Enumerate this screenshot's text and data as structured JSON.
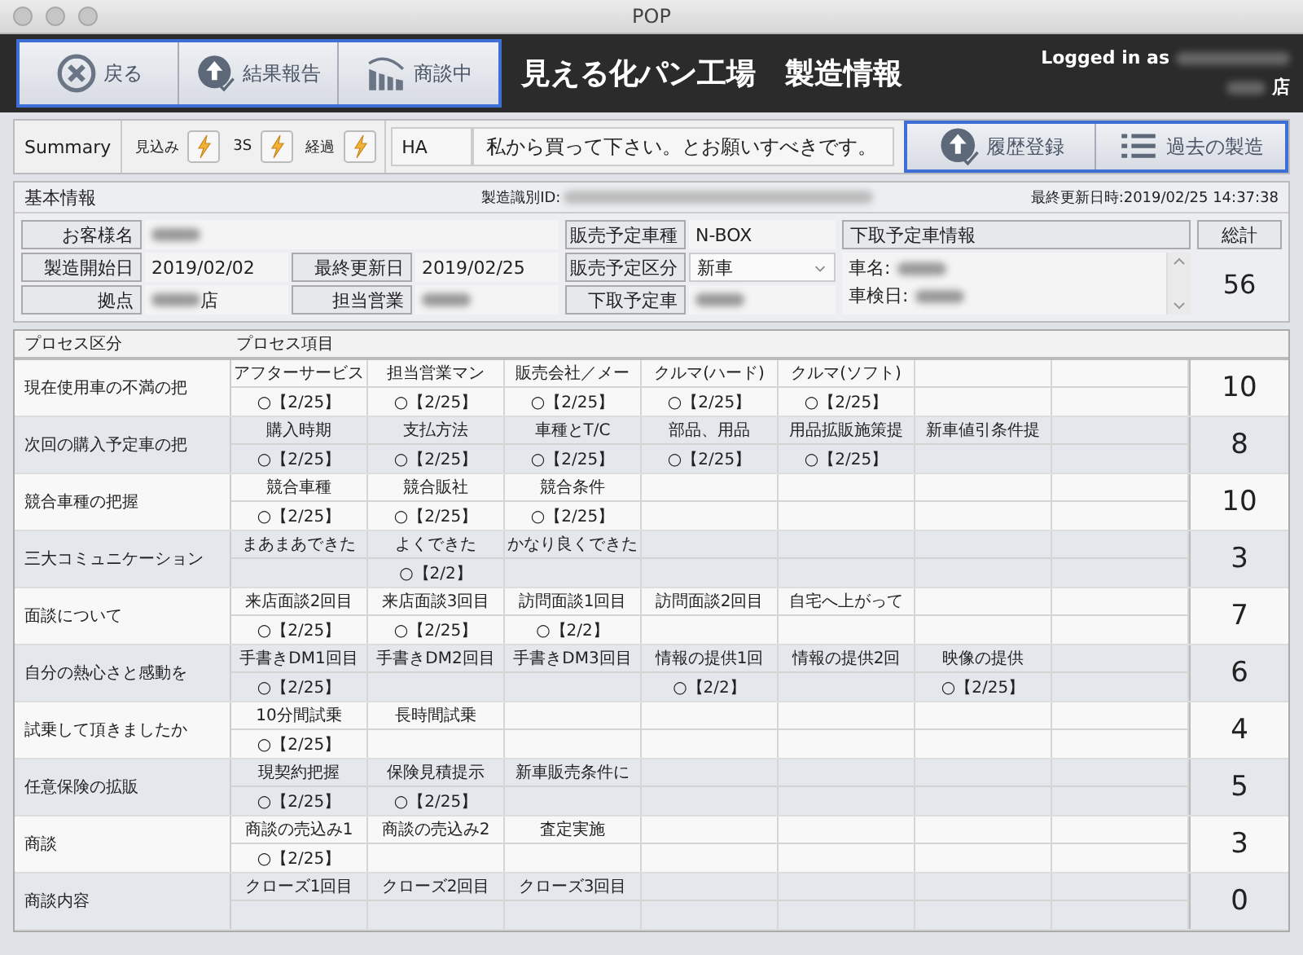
{
  "window": {
    "title": "POP"
  },
  "header": {
    "buttons": [
      {
        "label": "戻る",
        "kind": "close"
      },
      {
        "label": "結果報告",
        "kind": "upload"
      },
      {
        "label": "商談中",
        "kind": "factory"
      }
    ],
    "title": "見える化パン工場　製造情報",
    "login_label": "Logged in as",
    "login_suffix": "店"
  },
  "summary": {
    "label": "Summary",
    "badges": [
      {
        "label": "見込み"
      },
      {
        "label": "3S"
      },
      {
        "label": "経過"
      }
    ],
    "code": "HA",
    "message": "私から買って下さい。とお願いすべきです。",
    "buttons": [
      {
        "label": "履歴登録",
        "kind": "upload"
      },
      {
        "label": "過去の製造",
        "kind": "list"
      }
    ]
  },
  "basic_info": {
    "title": "基本情報",
    "id_label": "製造識別ID:",
    "updated": "最終更新日時:2019/02/25 14:37:38",
    "fields": [
      {
        "label": "お客様名",
        "value_blurred": true
      },
      {
        "label": "製造開始日",
        "value": "2019/02/02"
      },
      {
        "label": "最終更新日",
        "value": "2019/02/25"
      },
      {
        "label": "拠点",
        "value": "店",
        "value_blurred": true
      },
      {
        "label": "担当営業",
        "value_blurred": true
      }
    ],
    "car_fields": [
      {
        "label": "販売予定車種",
        "value": "N-BOX",
        "kind": "text"
      },
      {
        "label": "販売予定区分",
        "value": "新車",
        "kind": "select"
      },
      {
        "label": "下取予定車",
        "value_blurred": true,
        "kind": "text"
      }
    ],
    "trade_in": {
      "title": "下取予定車情報",
      "lines": [
        "車名:",
        "車検日:"
      ]
    },
    "total": {
      "label": "総計",
      "value": "56"
    }
  },
  "process": {
    "columns": [
      "プロセス区分",
      "プロセス項目"
    ],
    "rows": [
      {
        "category": "現在使用車の不満の把",
        "score": "10",
        "items": [
          {
            "name": "アフターサービス",
            "result": "○【2/25】"
          },
          {
            "name": "担当営業マン",
            "result": "○【2/25】"
          },
          {
            "name": "販売会社／メー",
            "result": "○【2/25】"
          },
          {
            "name": "クルマ(ハード)",
            "result": "○【2/25】"
          },
          {
            "name": "クルマ(ソフト)",
            "result": "○【2/25】"
          }
        ]
      },
      {
        "category": "次回の購入予定車の把",
        "score": "8",
        "items": [
          {
            "name": "購入時期",
            "result": "○【2/25】"
          },
          {
            "name": "支払方法",
            "result": "○【2/25】"
          },
          {
            "name": "車種とT/C",
            "result": "○【2/25】"
          },
          {
            "name": "部品、用品",
            "result": "○【2/25】"
          },
          {
            "name": "用品拡販施策提",
            "result": "○【2/25】"
          },
          {
            "name": "新車値引条件提"
          }
        ]
      },
      {
        "category": "競合車種の把握",
        "score": "10",
        "items": [
          {
            "name": "競合車種",
            "result": "○【2/25】"
          },
          {
            "name": "競合販社",
            "result": "○【2/25】"
          },
          {
            "name": "競合条件",
            "result": "○【2/25】"
          }
        ]
      },
      {
        "category": "三大コミュニケーション",
        "score": "3",
        "items": [
          {
            "name": "まあまあできた"
          },
          {
            "name": "よくできた",
            "result": "○【2/2】"
          },
          {
            "name": "かなり良くできた"
          }
        ]
      },
      {
        "category": "面談について",
        "score": "7",
        "items": [
          {
            "name": "来店面談2回目",
            "result": "○【2/25】"
          },
          {
            "name": "来店面談3回目",
            "result": "○【2/25】"
          },
          {
            "name": "訪問面談1回目",
            "result": "○【2/2】"
          },
          {
            "name": "訪問面談2回目"
          },
          {
            "name": "自宅へ上がって"
          }
        ]
      },
      {
        "category": "自分の熱心さと感動を",
        "score": "6",
        "items": [
          {
            "name": "手書きDM1回目",
            "result": "○【2/25】"
          },
          {
            "name": "手書きDM2回目"
          },
          {
            "name": "手書きDM3回目"
          },
          {
            "name": "情報の提供1回",
            "result": "○【2/2】"
          },
          {
            "name": "情報の提供2回"
          },
          {
            "name": "映像の提供",
            "result": "○【2/25】"
          }
        ]
      },
      {
        "category": "試乗して頂きましたか",
        "score": "4",
        "items": [
          {
            "name": "10分間試乗",
            "result": "○【2/25】"
          },
          {
            "name": "長時間試乗"
          }
        ]
      },
      {
        "category": "任意保険の拡販",
        "score": "5",
        "items": [
          {
            "name": "現契約把握",
            "result": "○【2/25】"
          },
          {
            "name": "保険見積提示",
            "result": "○【2/25】"
          },
          {
            "name": "新車販売条件に"
          }
        ]
      },
      {
        "category": "商談",
        "score": "3",
        "items": [
          {
            "name": "商談の売込み1",
            "result": "○【2/25】"
          },
          {
            "name": "商談の売込み2"
          },
          {
            "name": "査定実施"
          }
        ]
      },
      {
        "category": "商談内容",
        "score": "0",
        "items": [
          {
            "name": "クローズ1回目"
          },
          {
            "name": "クローズ2回目"
          },
          {
            "name": "クローズ3回目"
          }
        ]
      }
    ]
  }
}
